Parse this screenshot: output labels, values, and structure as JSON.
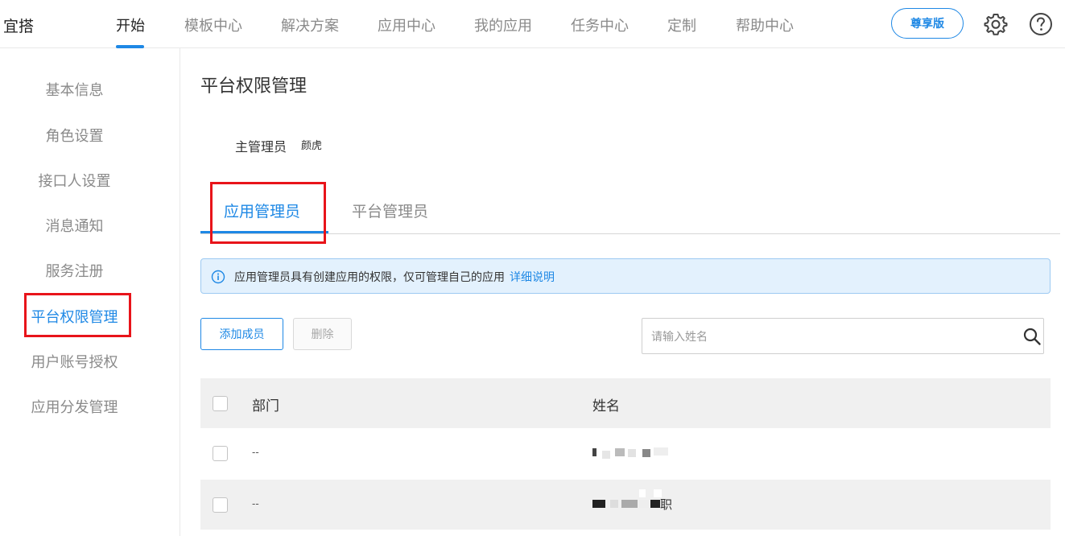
{
  "brand": {
    "logo_text": "宜搭"
  },
  "nav": {
    "items": [
      "开始",
      "模板中心",
      "解决方案",
      "应用中心",
      "我的应用",
      "任务中心",
      "定制",
      "帮助中心"
    ],
    "active_index": 0,
    "premium_label": "尊享版"
  },
  "icons": {
    "settings": "gear-icon",
    "help": "question-circle-icon",
    "info": "info-circle-icon",
    "search": "search-icon"
  },
  "sidebar": {
    "items": [
      "基本信息",
      "角色设置",
      "接口人设置",
      "消息通知",
      "服务注册",
      "平台权限管理",
      "用户账号授权",
      "应用分发管理"
    ],
    "active_index": 5
  },
  "main": {
    "title": "平台权限管理",
    "owner_label": "主管理员",
    "owner_name": "颜虎",
    "tabs": [
      "应用管理员",
      "平台管理员"
    ],
    "active_tab": 0,
    "info_text": "应用管理员具有创建应用的权限，仅可管理自己的应用",
    "info_link": "详细说明",
    "add_button": "添加成员",
    "delete_button": "删除",
    "search_placeholder": "请输入姓名"
  },
  "table": {
    "columns": [
      "部门",
      "姓名"
    ],
    "rows": [
      {
        "dept": "--",
        "name_visible_fragment": "",
        "name_blurred": true
      },
      {
        "dept": "--",
        "name_visible_fragment": "职",
        "name_blurred": true
      }
    ]
  },
  "colors": {
    "accent": "#1e88e5",
    "highlight_box": "#e8141a",
    "info_bg": "#e3f1fd"
  }
}
